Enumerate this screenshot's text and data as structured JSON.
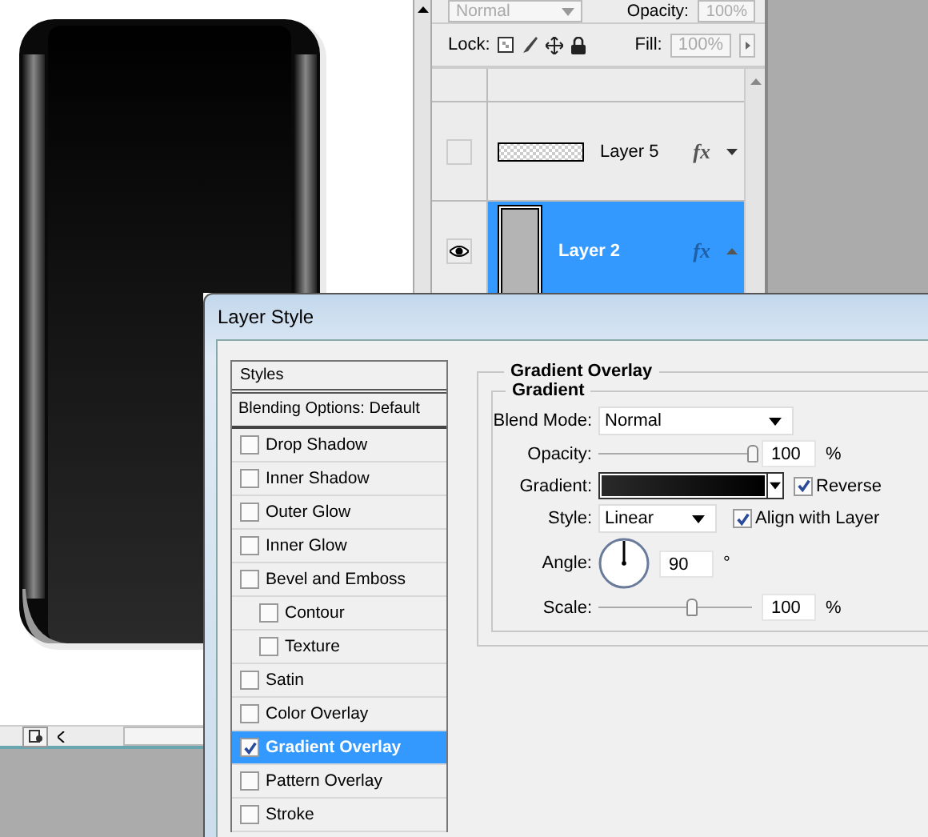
{
  "layers_panel": {
    "blend_mode": "Normal",
    "opacity_label": "Opacity:",
    "opacity": "100%",
    "lock_label": "Lock:",
    "fill_label": "Fill:",
    "fill": "100%",
    "layers": [
      {
        "name": "Layer 5",
        "kind": "pattern",
        "visible": false,
        "selected": false,
        "fx": "fx",
        "expanded": false
      },
      {
        "name": "Layer 2",
        "kind": "shape",
        "visible": true,
        "selected": true,
        "fx": "fx",
        "expanded": true
      }
    ]
  },
  "dialog": {
    "title": "Layer Style",
    "styles_list": {
      "title": "Styles",
      "blending_options": "Blending Options: Default",
      "effects": [
        {
          "label": "Drop Shadow",
          "checked": false,
          "selected": false
        },
        {
          "label": "Inner Shadow",
          "checked": false,
          "selected": false
        },
        {
          "label": "Outer Glow",
          "checked": false,
          "selected": false
        },
        {
          "label": "Inner Glow",
          "checked": false,
          "selected": false
        },
        {
          "label": "Bevel and Emboss",
          "checked": false,
          "selected": false,
          "children": [
            {
              "label": "Contour",
              "checked": false,
              "selected": false
            },
            {
              "label": "Texture",
              "checked": false,
              "selected": false
            }
          ]
        },
        {
          "label": "Satin",
          "checked": false,
          "selected": false
        },
        {
          "label": "Color Overlay",
          "checked": false,
          "selected": false
        },
        {
          "label": "Gradient Overlay",
          "checked": true,
          "selected": true
        },
        {
          "label": "Pattern Overlay",
          "checked": false,
          "selected": false
        },
        {
          "label": "Stroke",
          "checked": false,
          "selected": false
        }
      ]
    },
    "panel": {
      "title": "Gradient Overlay",
      "group_title": "Gradient",
      "blend_mode": {
        "label": "Blend Mode:",
        "value": "Normal"
      },
      "opacity": {
        "label": "Opacity:",
        "level": 1.0,
        "value": "100",
        "unit": "%"
      },
      "gradient": {
        "label": "Gradient:",
        "reverse": {
          "label": "Reverse",
          "checked": true
        }
      },
      "style": {
        "label": "Style:",
        "value": "Linear",
        "align": {
          "label": "Align with Layer",
          "checked": true
        }
      },
      "angle": {
        "label": "Angle:",
        "value": "90",
        "unit": "°"
      },
      "scale": {
        "label": "Scale:",
        "level": 0.6,
        "value": "100",
        "unit": "%"
      }
    }
  }
}
